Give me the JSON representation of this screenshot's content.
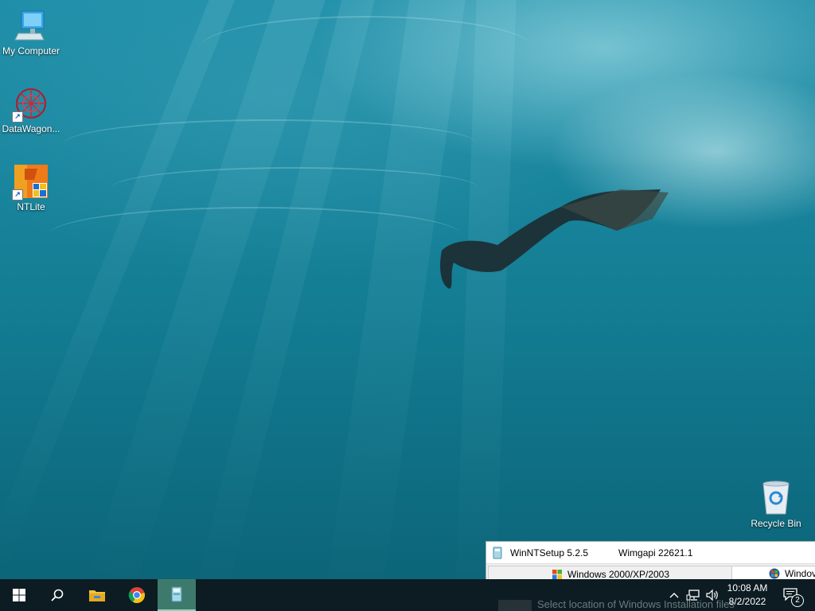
{
  "desktop": {
    "icons": [
      {
        "label": "My Computer",
        "icon": "computer-icon"
      },
      {
        "label": "DataWagon...",
        "icon": "datawagon-icon"
      },
      {
        "label": "NTLite",
        "icon": "ntlite-icon"
      },
      {
        "label": "Recycle Bin",
        "icon": "recycle-bin-icon"
      }
    ]
  },
  "app_window": {
    "title": "WinNTSetup 5.2.5",
    "wimgapi": "Wimgapi 22621.1",
    "tabs": [
      {
        "label": "Windows 2000/XP/2003"
      },
      {
        "label": "Windov"
      }
    ],
    "peek_text": "Select location of Windows Installation files"
  },
  "taskbar": {
    "buttons": [
      "start-icon",
      "search-icon",
      "file-explorer-icon",
      "chrome-icon",
      "winntsetup-icon"
    ],
    "tray": [
      "chevron-up-icon",
      "network-icon",
      "volume-icon"
    ],
    "time": "10:08 AM",
    "date": "8/2/2022",
    "notification_count": "2"
  },
  "colors": {
    "taskbar": "#0c1c22",
    "active_app": "#3e7a6c",
    "water": "#127a90"
  }
}
